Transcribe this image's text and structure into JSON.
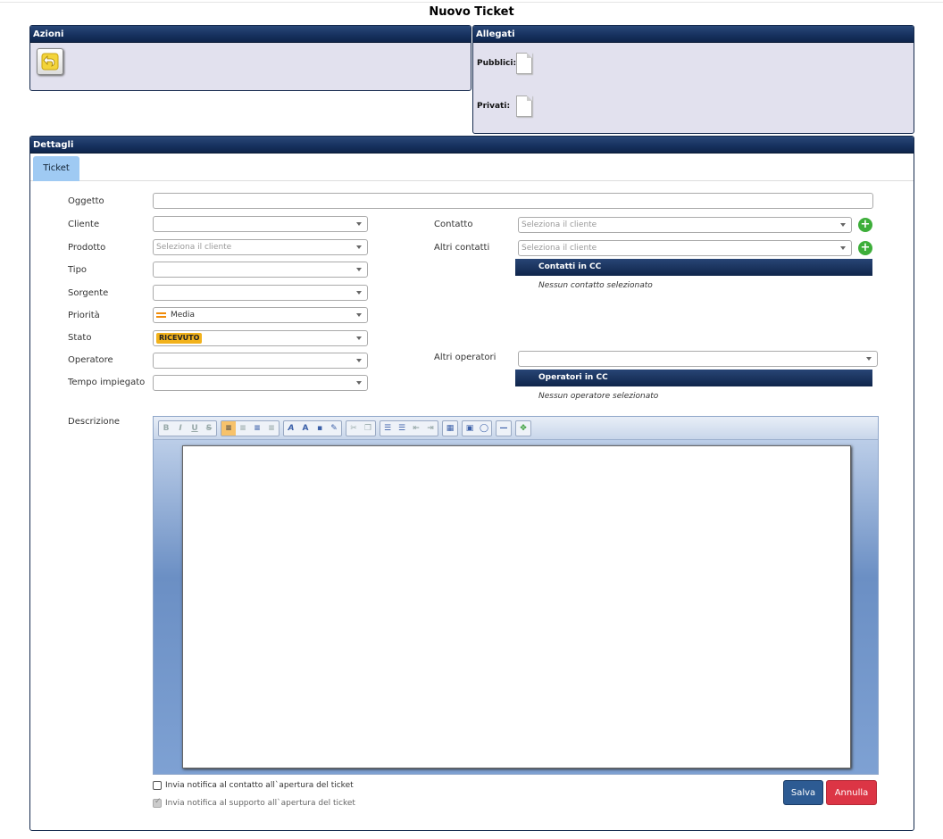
{
  "page": {
    "title": "Nuovo Ticket"
  },
  "azioni": {
    "title": "Azioni",
    "back_icon": "undo-arrow-icon"
  },
  "allegati": {
    "title": "Allegati",
    "pubblici_label": "Pubblici:",
    "privati_label": "Privati:",
    "doc_icon": "blank-document-icon"
  },
  "dettagli": {
    "title": "Dettagli",
    "tab": "Ticket",
    "labels": {
      "oggetto": "Oggetto",
      "cliente": "Cliente",
      "prodotto": "Prodotto",
      "tipo": "Tipo",
      "sorgente": "Sorgente",
      "priorita": "Priorità",
      "stato": "Stato",
      "operatore": "Operatore",
      "tempo": "Tempo impiegato",
      "contatto": "Contatto",
      "altri_contatti": "Altri contatti",
      "altri_operatori": "Altri operatori",
      "descrizione": "Descrizione"
    },
    "values": {
      "oggetto": "",
      "cliente": "",
      "prodotto_placeholder": "Seleziona il cliente",
      "tipo": "",
      "sorgente": "",
      "priorita": "Media",
      "stato": "RICEVUTO",
      "operatore": "",
      "tempo": "",
      "contatto_placeholder": "Seleziona il cliente",
      "altri_contatti_placeholder": "Seleziona il cliente",
      "altri_operatori": ""
    },
    "contatti_cc": {
      "header": "Contatti in CC",
      "empty": "Nessun contatto selezionato"
    },
    "operatori_cc": {
      "header": "Operatori in CC",
      "empty": "Nessun operatore selezionato"
    },
    "checkbox_contatto": "Invia notifica al contatto all`apertura del ticket",
    "checkbox_supporto": "Invia notifica al supporto all`apertura del ticket",
    "save_label": "Salva",
    "cancel_label": "Annulla"
  },
  "colors": {
    "header": "#173260",
    "save": "#2d5b93",
    "cancel": "#dc3545",
    "status_badge": "#f2b21b",
    "add": "#3dae3a"
  }
}
